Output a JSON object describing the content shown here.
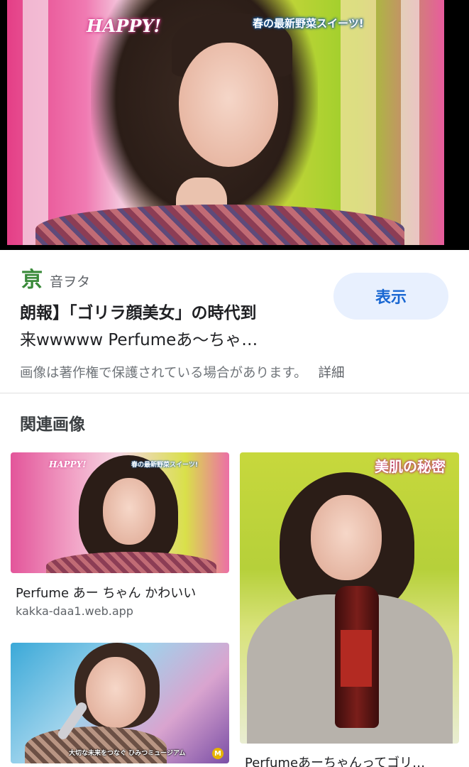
{
  "hero": {
    "logo_text": "HAPPY!",
    "caption": "春の最新野菜スイーツ!"
  },
  "source": {
    "site_icon_glyph": "亰",
    "site_icon_color": "#3a8a3a",
    "site_name": "音ヲタ"
  },
  "result": {
    "title_line1": "朗報】「ゴリラ顔美女」の時代到",
    "title_line2": "来wwwww Perfumeあ〜ちゃ…",
    "view_button_label": "表示",
    "copyright_notice": "画像は著作権で保護されている場合があります。",
    "details_link": "詳細"
  },
  "related": {
    "heading": "関連画像",
    "items": [
      {
        "overlay_logo": "HAPPY!",
        "overlay_caption": "春の最新野菜スイーツ!",
        "title": "Perfume あー ちゃん かわいい",
        "source": "kakka-daa1.web.app"
      },
      {
        "overlay_caption": "美肌の秘密",
        "title": "Perfumeあーちゃんってゴリ…"
      },
      {
        "overlay_caption": "大切な未来をつなぐ ひみつミュージアム",
        "badge": "M"
      }
    ]
  },
  "colors": {
    "accent": "#1967d2",
    "button_bg": "#e8f0fe",
    "secondary_text": "#70757a"
  }
}
